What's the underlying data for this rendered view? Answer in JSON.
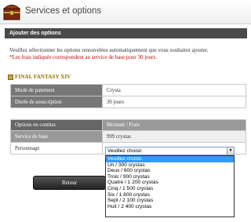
{
  "header": {
    "title": "Services et options",
    "logo_icon": "treasure-chest-icon"
  },
  "section": {
    "title": "Ajouter des options"
  },
  "intro": {
    "line1": "Veuillez sélectionner les options renouvelées automatiquement que vous souhaitez ajouter.",
    "note": "*Les frais indiqués correspondent au service de base pour 30 jours."
  },
  "game": {
    "title": "FINAL FANTASY XIV",
    "icon": "game-icon"
  },
  "info_table": {
    "rows": [
      {
        "label": "Mode de paiement",
        "value": "Crysta"
      },
      {
        "label": "Durée de souscription",
        "value": "30 jours"
      }
    ]
  },
  "options_table": {
    "headers": [
      "Options en continu",
      "Montant / Frais"
    ],
    "base_service": {
      "label": "Service de base",
      "value": "999 crystas"
    },
    "character": {
      "label": "Personnage"
    }
  },
  "select": {
    "value": "Veuillez choisir.",
    "options": [
      "Veuillez choisir.",
      "Un / 300 crystas",
      "Deux / 600 crystas",
      "Trois / 900 crystas",
      "Quatre / 1 200 crystas",
      "Cinq / 1 500 crystas",
      "Six / 1 800 crystas",
      "Sept / 2 100 crystas",
      "Huit / 2 400 crystas"
    ],
    "selected_index": 0
  },
  "buttons": {
    "back": "Retour"
  },
  "colors": {
    "section_bar": "#4a4a4a",
    "note_red": "#c00000",
    "game_title": "#9a7100",
    "dropdown_highlight": "#3399ff"
  }
}
